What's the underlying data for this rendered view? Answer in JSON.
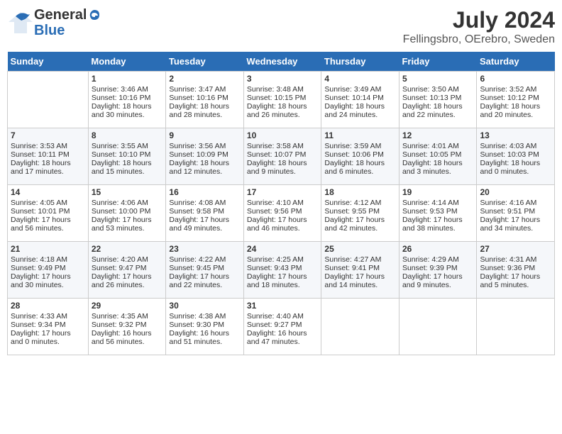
{
  "header": {
    "logo_general": "General",
    "logo_blue": "Blue",
    "month_title": "July 2024",
    "location": "Fellingsbro, OErebro, Sweden"
  },
  "weekdays": [
    "Sunday",
    "Monday",
    "Tuesday",
    "Wednesday",
    "Thursday",
    "Friday",
    "Saturday"
  ],
  "weeks": [
    [
      {
        "day": "",
        "sunrise": "",
        "sunset": "",
        "daylight": ""
      },
      {
        "day": "1",
        "sunrise": "Sunrise: 3:46 AM",
        "sunset": "Sunset: 10:16 PM",
        "daylight": "Daylight: 18 hours and 30 minutes."
      },
      {
        "day": "2",
        "sunrise": "Sunrise: 3:47 AM",
        "sunset": "Sunset: 10:16 PM",
        "daylight": "Daylight: 18 hours and 28 minutes."
      },
      {
        "day": "3",
        "sunrise": "Sunrise: 3:48 AM",
        "sunset": "Sunset: 10:15 PM",
        "daylight": "Daylight: 18 hours and 26 minutes."
      },
      {
        "day": "4",
        "sunrise": "Sunrise: 3:49 AM",
        "sunset": "Sunset: 10:14 PM",
        "daylight": "Daylight: 18 hours and 24 minutes."
      },
      {
        "day": "5",
        "sunrise": "Sunrise: 3:50 AM",
        "sunset": "Sunset: 10:13 PM",
        "daylight": "Daylight: 18 hours and 22 minutes."
      },
      {
        "day": "6",
        "sunrise": "Sunrise: 3:52 AM",
        "sunset": "Sunset: 10:12 PM",
        "daylight": "Daylight: 18 hours and 20 minutes."
      }
    ],
    [
      {
        "day": "7",
        "sunrise": "Sunrise: 3:53 AM",
        "sunset": "Sunset: 10:11 PM",
        "daylight": "Daylight: 18 hours and 17 minutes."
      },
      {
        "day": "8",
        "sunrise": "Sunrise: 3:55 AM",
        "sunset": "Sunset: 10:10 PM",
        "daylight": "Daylight: 18 hours and 15 minutes."
      },
      {
        "day": "9",
        "sunrise": "Sunrise: 3:56 AM",
        "sunset": "Sunset: 10:09 PM",
        "daylight": "Daylight: 18 hours and 12 minutes."
      },
      {
        "day": "10",
        "sunrise": "Sunrise: 3:58 AM",
        "sunset": "Sunset: 10:07 PM",
        "daylight": "Daylight: 18 hours and 9 minutes."
      },
      {
        "day": "11",
        "sunrise": "Sunrise: 3:59 AM",
        "sunset": "Sunset: 10:06 PM",
        "daylight": "Daylight: 18 hours and 6 minutes."
      },
      {
        "day": "12",
        "sunrise": "Sunrise: 4:01 AM",
        "sunset": "Sunset: 10:05 PM",
        "daylight": "Daylight: 18 hours and 3 minutes."
      },
      {
        "day": "13",
        "sunrise": "Sunrise: 4:03 AM",
        "sunset": "Sunset: 10:03 PM",
        "daylight": "Daylight: 18 hours and 0 minutes."
      }
    ],
    [
      {
        "day": "14",
        "sunrise": "Sunrise: 4:05 AM",
        "sunset": "Sunset: 10:01 PM",
        "daylight": "Daylight: 17 hours and 56 minutes."
      },
      {
        "day": "15",
        "sunrise": "Sunrise: 4:06 AM",
        "sunset": "Sunset: 10:00 PM",
        "daylight": "Daylight: 17 hours and 53 minutes."
      },
      {
        "day": "16",
        "sunrise": "Sunrise: 4:08 AM",
        "sunset": "Sunset: 9:58 PM",
        "daylight": "Daylight: 17 hours and 49 minutes."
      },
      {
        "day": "17",
        "sunrise": "Sunrise: 4:10 AM",
        "sunset": "Sunset: 9:56 PM",
        "daylight": "Daylight: 17 hours and 46 minutes."
      },
      {
        "day": "18",
        "sunrise": "Sunrise: 4:12 AM",
        "sunset": "Sunset: 9:55 PM",
        "daylight": "Daylight: 17 hours and 42 minutes."
      },
      {
        "day": "19",
        "sunrise": "Sunrise: 4:14 AM",
        "sunset": "Sunset: 9:53 PM",
        "daylight": "Daylight: 17 hours and 38 minutes."
      },
      {
        "day": "20",
        "sunrise": "Sunrise: 4:16 AM",
        "sunset": "Sunset: 9:51 PM",
        "daylight": "Daylight: 17 hours and 34 minutes."
      }
    ],
    [
      {
        "day": "21",
        "sunrise": "Sunrise: 4:18 AM",
        "sunset": "Sunset: 9:49 PM",
        "daylight": "Daylight: 17 hours and 30 minutes."
      },
      {
        "day": "22",
        "sunrise": "Sunrise: 4:20 AM",
        "sunset": "Sunset: 9:47 PM",
        "daylight": "Daylight: 17 hours and 26 minutes."
      },
      {
        "day": "23",
        "sunrise": "Sunrise: 4:22 AM",
        "sunset": "Sunset: 9:45 PM",
        "daylight": "Daylight: 17 hours and 22 minutes."
      },
      {
        "day": "24",
        "sunrise": "Sunrise: 4:25 AM",
        "sunset": "Sunset: 9:43 PM",
        "daylight": "Daylight: 17 hours and 18 minutes."
      },
      {
        "day": "25",
        "sunrise": "Sunrise: 4:27 AM",
        "sunset": "Sunset: 9:41 PM",
        "daylight": "Daylight: 17 hours and 14 minutes."
      },
      {
        "day": "26",
        "sunrise": "Sunrise: 4:29 AM",
        "sunset": "Sunset: 9:39 PM",
        "daylight": "Daylight: 17 hours and 9 minutes."
      },
      {
        "day": "27",
        "sunrise": "Sunrise: 4:31 AM",
        "sunset": "Sunset: 9:36 PM",
        "daylight": "Daylight: 17 hours and 5 minutes."
      }
    ],
    [
      {
        "day": "28",
        "sunrise": "Sunrise: 4:33 AM",
        "sunset": "Sunset: 9:34 PM",
        "daylight": "Daylight: 17 hours and 0 minutes."
      },
      {
        "day": "29",
        "sunrise": "Sunrise: 4:35 AM",
        "sunset": "Sunset: 9:32 PM",
        "daylight": "Daylight: 16 hours and 56 minutes."
      },
      {
        "day": "30",
        "sunrise": "Sunrise: 4:38 AM",
        "sunset": "Sunset: 9:30 PM",
        "daylight": "Daylight: 16 hours and 51 minutes."
      },
      {
        "day": "31",
        "sunrise": "Sunrise: 4:40 AM",
        "sunset": "Sunset: 9:27 PM",
        "daylight": "Daylight: 16 hours and 47 minutes."
      },
      {
        "day": "",
        "sunrise": "",
        "sunset": "",
        "daylight": ""
      },
      {
        "day": "",
        "sunrise": "",
        "sunset": "",
        "daylight": ""
      },
      {
        "day": "",
        "sunrise": "",
        "sunset": "",
        "daylight": ""
      }
    ]
  ]
}
